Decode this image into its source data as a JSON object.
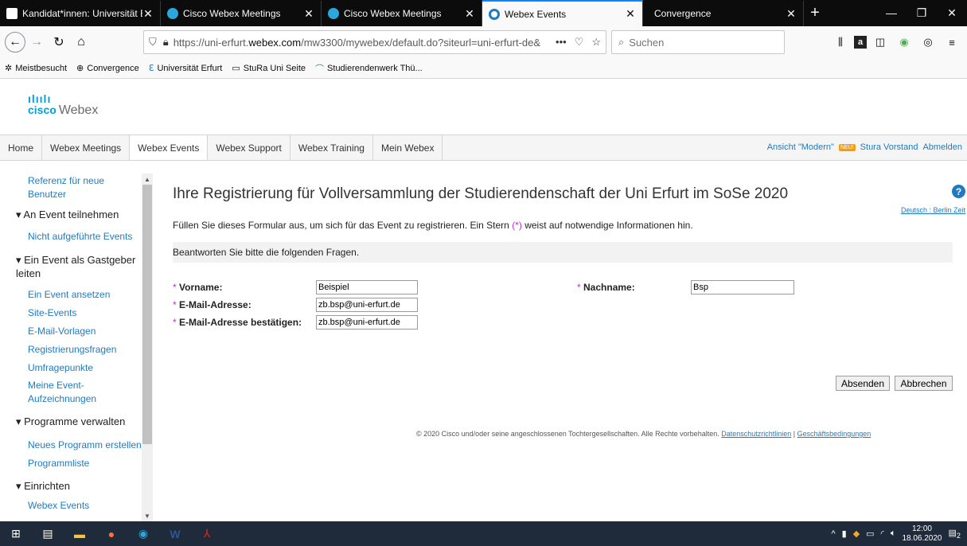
{
  "browser": {
    "tabs": [
      {
        "title": "Kandidat*innen: Universität Erf",
        "active": false
      },
      {
        "title": "Cisco Webex Meetings",
        "active": false
      },
      {
        "title": "Cisco Webex Meetings",
        "active": false
      },
      {
        "title": "Webex Events",
        "active": true
      },
      {
        "title": "Convergence",
        "active": false
      }
    ],
    "url_prefix": "https://uni-erfurt.",
    "url_domain": "webex.com",
    "url_rest": "/mw3300/mywebex/default.do?siteurl=uni-erfurt-de&",
    "search_placeholder": "Suchen",
    "bookmarks": [
      "Meistbesucht",
      "Convergence",
      "Universität Erfurt",
      "StuRa Uni Seite",
      "Studierendenwerk Thü..."
    ]
  },
  "logo": {
    "bars": "ılıılı",
    "cisco": "cisco",
    "webex": "Webex"
  },
  "menu": {
    "items": [
      "Home",
      "Webex Meetings",
      "Webex Events",
      "Webex Support",
      "Webex Training",
      "Mein Webex"
    ],
    "ansicht": "Ansicht \"Modern\"",
    "new_badge": "NEU!",
    "user": "Stura Vorstand",
    "logout": "Abmelden"
  },
  "sidebar": {
    "referenz": "Referenz für neue Benutzer",
    "an_event": "An Event teilnehmen",
    "nicht_aufgefuehrt": "Nicht aufgeführte Events",
    "gastgeber": "Ein Event als Gastgeber leiten",
    "ansetzen": "Ein Event ansetzen",
    "site_events": "Site-Events",
    "email_vorlagen": "E-Mail-Vorlagen",
    "reg_fragen": "Registrierungsfragen",
    "umfrage": "Umfragepunkte",
    "aufzeichnungen": "Meine Event-Aufzeichnungen",
    "programme": "Programme verwalten",
    "neues_programm": "Neues Programm erstellen",
    "programmliste": "Programmliste",
    "einrichten": "Einrichten",
    "webex_events": "Webex Events"
  },
  "main": {
    "title": "Ihre Registrierung für Vollversammlung der Studierendenschaft der Uni Erfurt im SoSe 2020",
    "lang_tz": "Deutsch : Berlin Zeit",
    "intro_before": "Füllen Sie dieses Formular aus, um sich für das Event zu registrieren. Ein Stern ",
    "intro_star": "(*)",
    "intro_after": " weist auf notwendige Informationen hin.",
    "section": "Beantworten Sie bitte die folgenden Fragen.",
    "req_marker": "*",
    "fields": {
      "vorname_label": "Vorname:",
      "vorname_value": "Beispiel",
      "nachname_label": "Nachname:",
      "nachname_value": "Bsp",
      "email_label": "E-Mail-Adresse:",
      "email_value": "zb.bsp@uni-erfurt.de",
      "email_confirm_label": "E-Mail-Adresse bestätigen:",
      "email_confirm_value": "zb.bsp@uni-erfurt.de"
    },
    "submit": "Absenden",
    "cancel": "Abbrechen",
    "footer_text": "© 2020 Cisco und/oder seine angeschlossenen Tochtergesellschaften. Alle Rechte vorbehalten.",
    "footer_privacy": "Datenschutzrichtlinien",
    "footer_sep": "|",
    "footer_terms": "Geschäftsbedingungen"
  },
  "taskbar": {
    "time": "12:00",
    "date": "18.06.2020",
    "notif_count": "2"
  }
}
